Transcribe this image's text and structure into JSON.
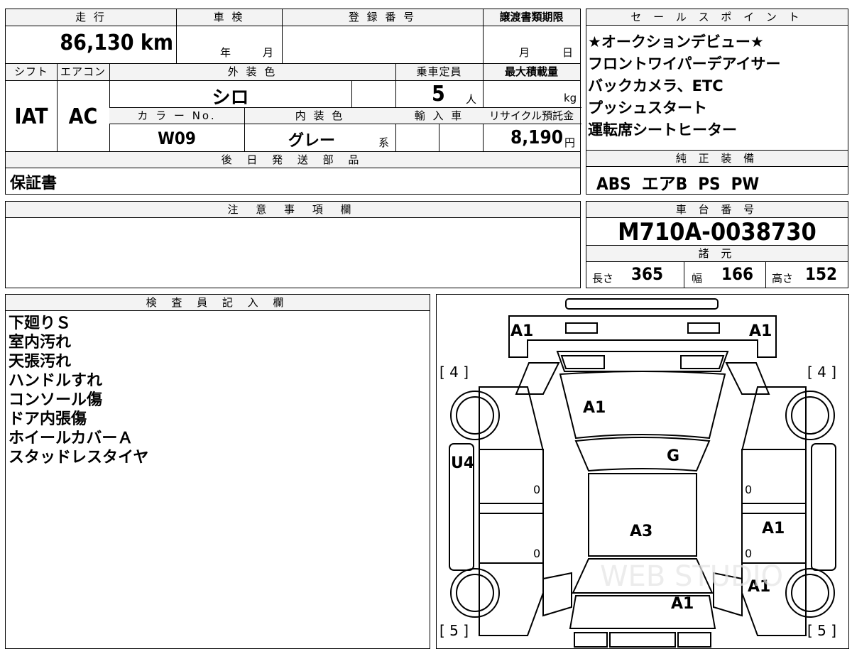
{
  "main_info": {
    "mileage_label": "走 行",
    "mileage_value": "86,130 km",
    "shaken_label": "車 検",
    "shaken_year": "年",
    "shaken_month": "月",
    "reg_label": "登 録 番 号",
    "deadline_label": "譲渡書類期限",
    "deadline_month": "月",
    "deadline_day": "日",
    "shift_label": "シフト",
    "shift_value": "IAT",
    "ac_label": "エアコン",
    "ac_value": "AC",
    "exterior_label": "外 装 色",
    "exterior_value": "シロ",
    "capacity_label": "乗車定員",
    "capacity_value": "5",
    "capacity_unit": "人",
    "max_load_label": "最大積載量",
    "max_load_unit": "kg",
    "color_no_label": "カ ラ ー No.",
    "color_no_value": "W09",
    "interior_label": "内 装 色",
    "interior_value": "グレー",
    "interior_suffix": "系",
    "import_label": "輸 入 車",
    "recycle_label": "リサイクル預託金",
    "recycle_value": "8,190",
    "recycle_unit": "円",
    "later_parts_label": "後 日 発 送 部 品",
    "later_parts_value": "保証書"
  },
  "sales_points": {
    "label": "セ ー ル ス ポ イ ン ト",
    "items": [
      "★オークションデビュー★",
      "フロントワイパーデアイサー",
      "バックカメラ、ETC",
      "プッシュスタート",
      "運転席シートヒーター"
    ]
  },
  "genuine_equipment": {
    "label": "純 正 装 備",
    "value": "ABS  エアB  PS  PW"
  },
  "caution": {
    "label": "注 意 事 項 欄"
  },
  "chassis": {
    "label": "車 台 番 号",
    "value": "M710A-0038730"
  },
  "specs": {
    "label": "諸 元",
    "length_label": "長さ",
    "length_value": "365",
    "width_label": "幅",
    "width_value": "166",
    "height_label": "高さ",
    "height_value": "152"
  },
  "inspector": {
    "label": "検 査 員 記 入 欄",
    "notes": [
      "下廻りＳ",
      "室内汚れ",
      "天張汚れ",
      "ハンドルすれ",
      "コンソール傷",
      "ドア内張傷",
      "ホイールカバーＡ",
      "スタッドレスタイヤ"
    ]
  },
  "diagram": {
    "front_left": "A1",
    "front_right": "A1",
    "tire_fl": "[ 4 ]",
    "tire_fr": "[ 4 ]",
    "tire_rl": "[ 5 ]",
    "tire_rr": "[ 5 ]",
    "hood": "A1",
    "windshield": "G",
    "left_panel": "U4",
    "roof": "A3",
    "right_rear_door": "A1",
    "right_rear": "A1",
    "rear": "A1",
    "door_lf": "0",
    "door_lr": "0",
    "door_rf": "0",
    "door_rr": "0",
    "watermark": "WEB STUDIO"
  }
}
